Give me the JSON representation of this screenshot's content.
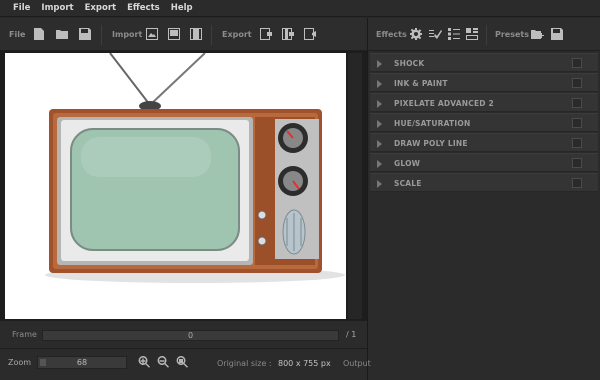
{
  "menu": {
    "items": [
      "File",
      "Import",
      "Export",
      "Effects",
      "Help"
    ]
  },
  "toolbar": {
    "file_label": "File",
    "import_label": "Import",
    "export_label": "Export",
    "effects_label": "Effects",
    "presets_label": "Presets",
    "file_icons": [
      "new-file-icon",
      "open-folder-icon",
      "save-icon"
    ],
    "import_icons": [
      "import-image-icon",
      "import-image-sequence-icon",
      "import-video-icon"
    ],
    "export_icons": [
      "export-image-icon",
      "export-sequence-icon",
      "export-video-icon"
    ],
    "effects_icons": [
      "settings-gear-icon",
      "apply-effect-icon",
      "effect-list-icon",
      "effect-stack-icon"
    ],
    "presets_icons": [
      "open-preset-icon",
      "save-preset-icon"
    ]
  },
  "effects": [
    {
      "name": "SHOCK",
      "enabled": false
    },
    {
      "name": "INK & PAINT",
      "enabled": false
    },
    {
      "name": "PIXELATE ADVANCED 2",
      "enabled": false
    },
    {
      "name": "HUE/SATURATION",
      "enabled": false
    },
    {
      "name": "DRAW POLY LINE",
      "enabled": false
    },
    {
      "name": "GLOW",
      "enabled": false
    },
    {
      "name": "SCALE",
      "enabled": false
    }
  ],
  "frame": {
    "label": "Frame",
    "value": "0",
    "total": "/ 1"
  },
  "zoom": {
    "label": "Zoom",
    "value": "68",
    "icons": [
      "zoom-in-icon",
      "zoom-out-icon",
      "zoom-fit-icon"
    ]
  },
  "original_size": {
    "label": "Original size :",
    "value": "800 x 755 px"
  },
  "output": {
    "label": "Output"
  },
  "colors": {
    "background": "#2a2a2a",
    "panel": "#2d2d2d",
    "canvas": "#ffffff",
    "tv_wood": "#a0522d",
    "tv_screen": "#9fc4b0"
  }
}
